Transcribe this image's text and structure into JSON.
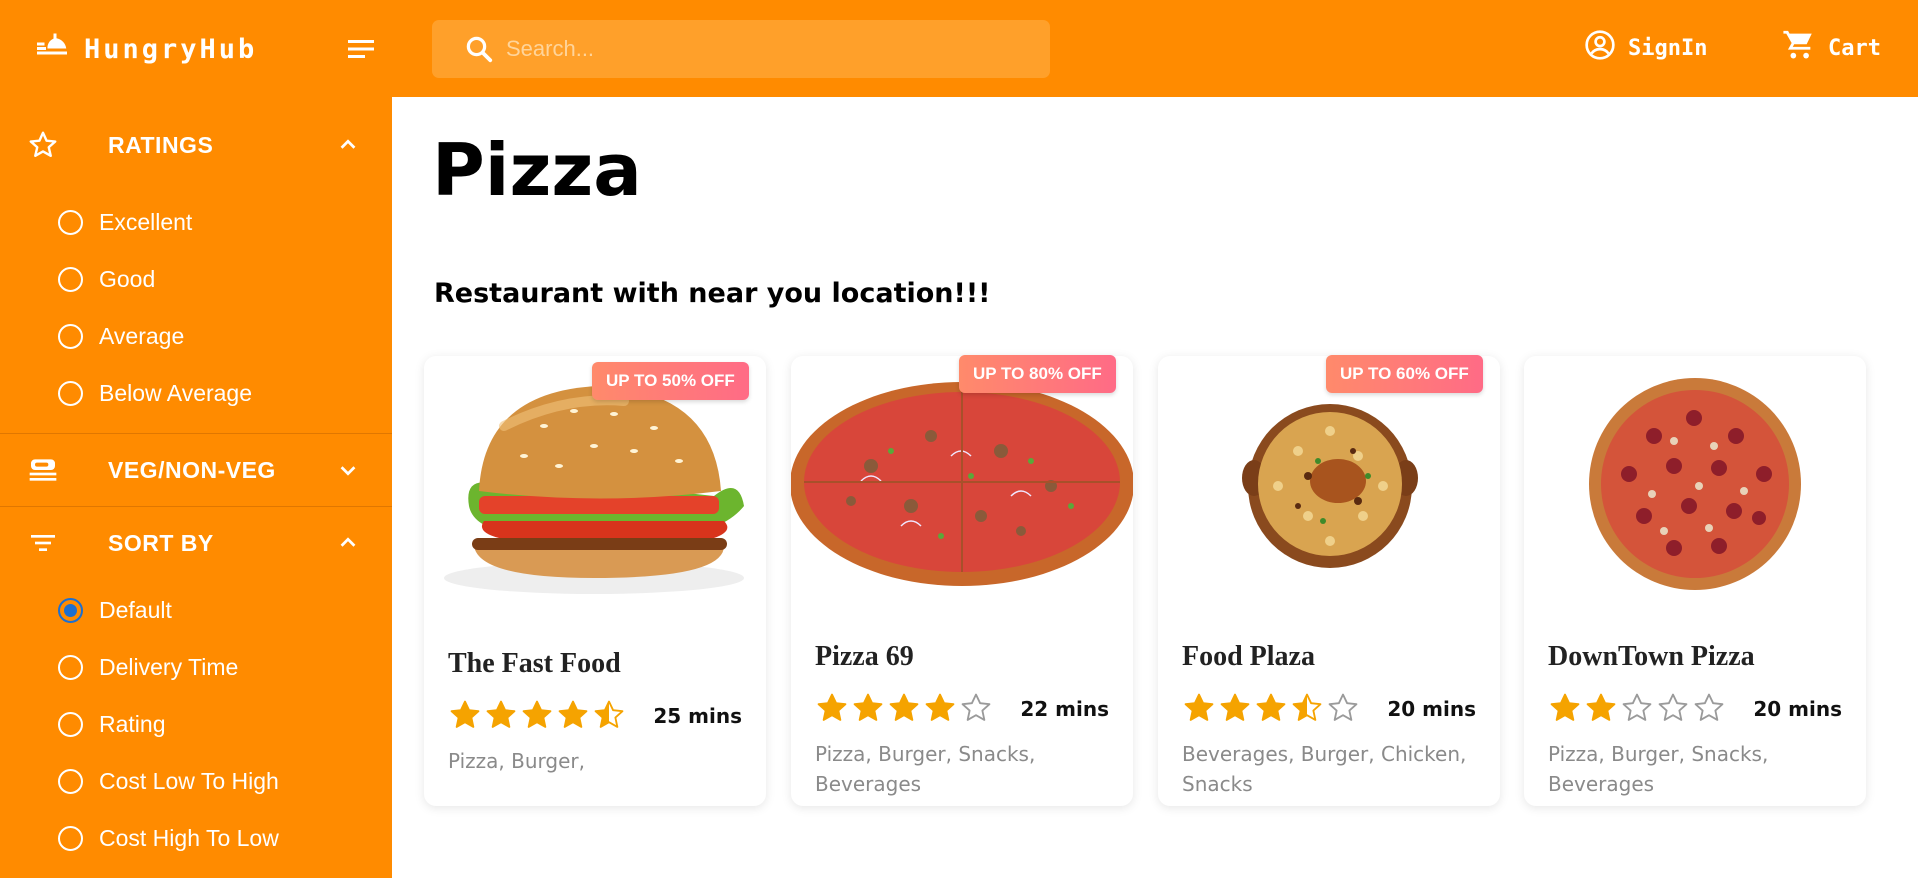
{
  "header": {
    "brand": "HungryHub",
    "search_placeholder": "Search...",
    "signin_label": "SignIn",
    "cart_label": "Cart",
    "accent_color": "#ff8b00"
  },
  "sidebar": {
    "sections": [
      {
        "title": "RATINGS",
        "icon": "star-outline-icon",
        "expanded": true,
        "options": [
          "Excellent",
          "Good",
          "Average",
          "Below Average"
        ]
      },
      {
        "title": "VEG/NON-VEG",
        "icon": "food-tray-icon",
        "expanded": false,
        "options": []
      },
      {
        "title": "SORT BY",
        "icon": "sort-icon",
        "expanded": true,
        "options": [
          "Default",
          "Delivery Time",
          "Rating",
          "Cost Low To High",
          "Cost High To Low"
        ],
        "selected": "Default"
      }
    ]
  },
  "main": {
    "title": "Pizza",
    "subtitle": "Restaurant with near you location!!!",
    "restaurants": [
      {
        "name": "The Fast Food",
        "badge": "UP TO 50% OFF",
        "rating": 4.5,
        "time": "25 mins",
        "cuisines": "Pizza, Burger,",
        "image": "burger"
      },
      {
        "name": "Pizza 69",
        "badge": "UP TO 80% OFF",
        "rating": 4,
        "time": "22 mins",
        "cuisines": "Pizza, Burger, Snacks, Beverages",
        "image": "pizza-veg"
      },
      {
        "name": "Food Plaza",
        "badge": "UP TO 60% OFF",
        "rating": 3.5,
        "time": "20 mins",
        "cuisines": "Beverages, Burger, Chicken, Snacks",
        "image": "biryani"
      },
      {
        "name": "DownTown Pizza",
        "badge": "",
        "rating": 2,
        "time": "20 mins",
        "cuisines": "Pizza, Burger, Snacks, Beverages",
        "image": "pizza-pepperoni"
      }
    ]
  }
}
